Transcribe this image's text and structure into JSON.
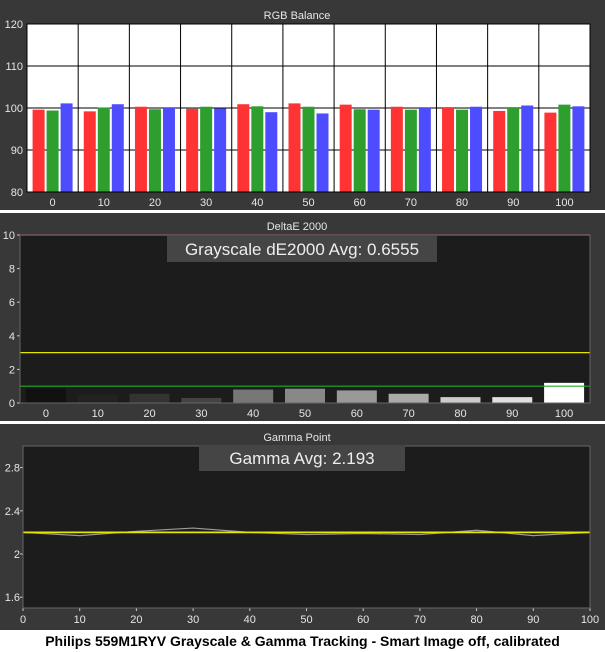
{
  "footer": "Philips 559M1RYV Grayscale & Gamma Tracking - Smart Image off, calibrated",
  "chart_data": [
    {
      "type": "bar",
      "title": "RGB Balance",
      "categories": [
        "0",
        "10",
        "20",
        "30",
        "40",
        "50",
        "60",
        "70",
        "80",
        "90",
        "100"
      ],
      "ylim": [
        80,
        120
      ],
      "yticks": [
        80,
        90,
        100,
        110,
        120
      ],
      "grid": true,
      "series": [
        {
          "color": "#ff3333",
          "values": [
            99.6,
            99.2,
            100.3,
            99.8,
            100.9,
            101.1,
            100.8,
            100.3,
            100.0,
            99.3,
            98.9
          ]
        },
        {
          "color": "#2e9e2e",
          "values": [
            99.4,
            100.1,
            99.7,
            100.3,
            100.4,
            100.3,
            99.7,
            99.6,
            99.6,
            100.0,
            100.8
          ]
        },
        {
          "color": "#4d4dff",
          "values": [
            101.1,
            100.9,
            100.0,
            99.9,
            99.0,
            98.7,
            99.6,
            100.0,
            100.3,
            100.6,
            100.4
          ]
        }
      ],
      "colors": {
        "background": "#383838",
        "plot": "#ffffff",
        "grid": "#000000"
      }
    },
    {
      "type": "bar",
      "title": "DeltaE 2000",
      "annotation": "Grayscale dE2000 Avg: 0.6555",
      "categories": [
        "0",
        "10",
        "20",
        "30",
        "40",
        "50",
        "60",
        "70",
        "80",
        "90",
        "100"
      ],
      "ylim": [
        0,
        10
      ],
      "yticks": [
        0,
        2,
        4,
        6,
        8,
        10
      ],
      "values": [
        0.85,
        0.5,
        0.55,
        0.3,
        0.8,
        0.85,
        0.75,
        0.55,
        0.35,
        0.35,
        1.2
      ],
      "bar_shades": [
        "#111111",
        "#222222",
        "#333333",
        "#444444",
        "#777777",
        "#888888",
        "#999999",
        "#aaaaaa",
        "#cccccc",
        "#e0e0e0",
        "#ffffff"
      ],
      "reference_lines": [
        {
          "value": 10,
          "color": "#ff4444"
        },
        {
          "value": 3,
          "color": "#e6e600"
        },
        {
          "value": 1,
          "color": "#22aa22"
        }
      ],
      "colors": {
        "background": "#383838",
        "plot": "#1c1c1c"
      }
    },
    {
      "type": "line",
      "title": "Gamma Point",
      "annotation": "Gamma Avg: 2.193",
      "x": [
        0,
        10,
        20,
        30,
        40,
        50,
        60,
        70,
        80,
        90,
        100
      ],
      "xlim": [
        0,
        100
      ],
      "xticks": [
        0,
        10,
        20,
        30,
        40,
        50,
        60,
        70,
        80,
        90,
        100
      ],
      "ylim": [
        1.5,
        3.0
      ],
      "yticks": [
        1.6,
        2.0,
        2.4,
        2.8
      ],
      "series": [
        {
          "color": "#e6e600",
          "values": [
            2.2,
            2.2,
            2.2,
            2.2,
            2.2,
            2.2,
            2.2,
            2.2,
            2.2,
            2.2,
            2.2
          ]
        },
        {
          "color": "#9a9a9a",
          "values": [
            2.2,
            2.17,
            2.21,
            2.24,
            2.2,
            2.18,
            2.19,
            2.18,
            2.22,
            2.17,
            2.2
          ]
        }
      ],
      "colors": {
        "background": "#383838",
        "plot": "#1c1c1c"
      }
    }
  ]
}
